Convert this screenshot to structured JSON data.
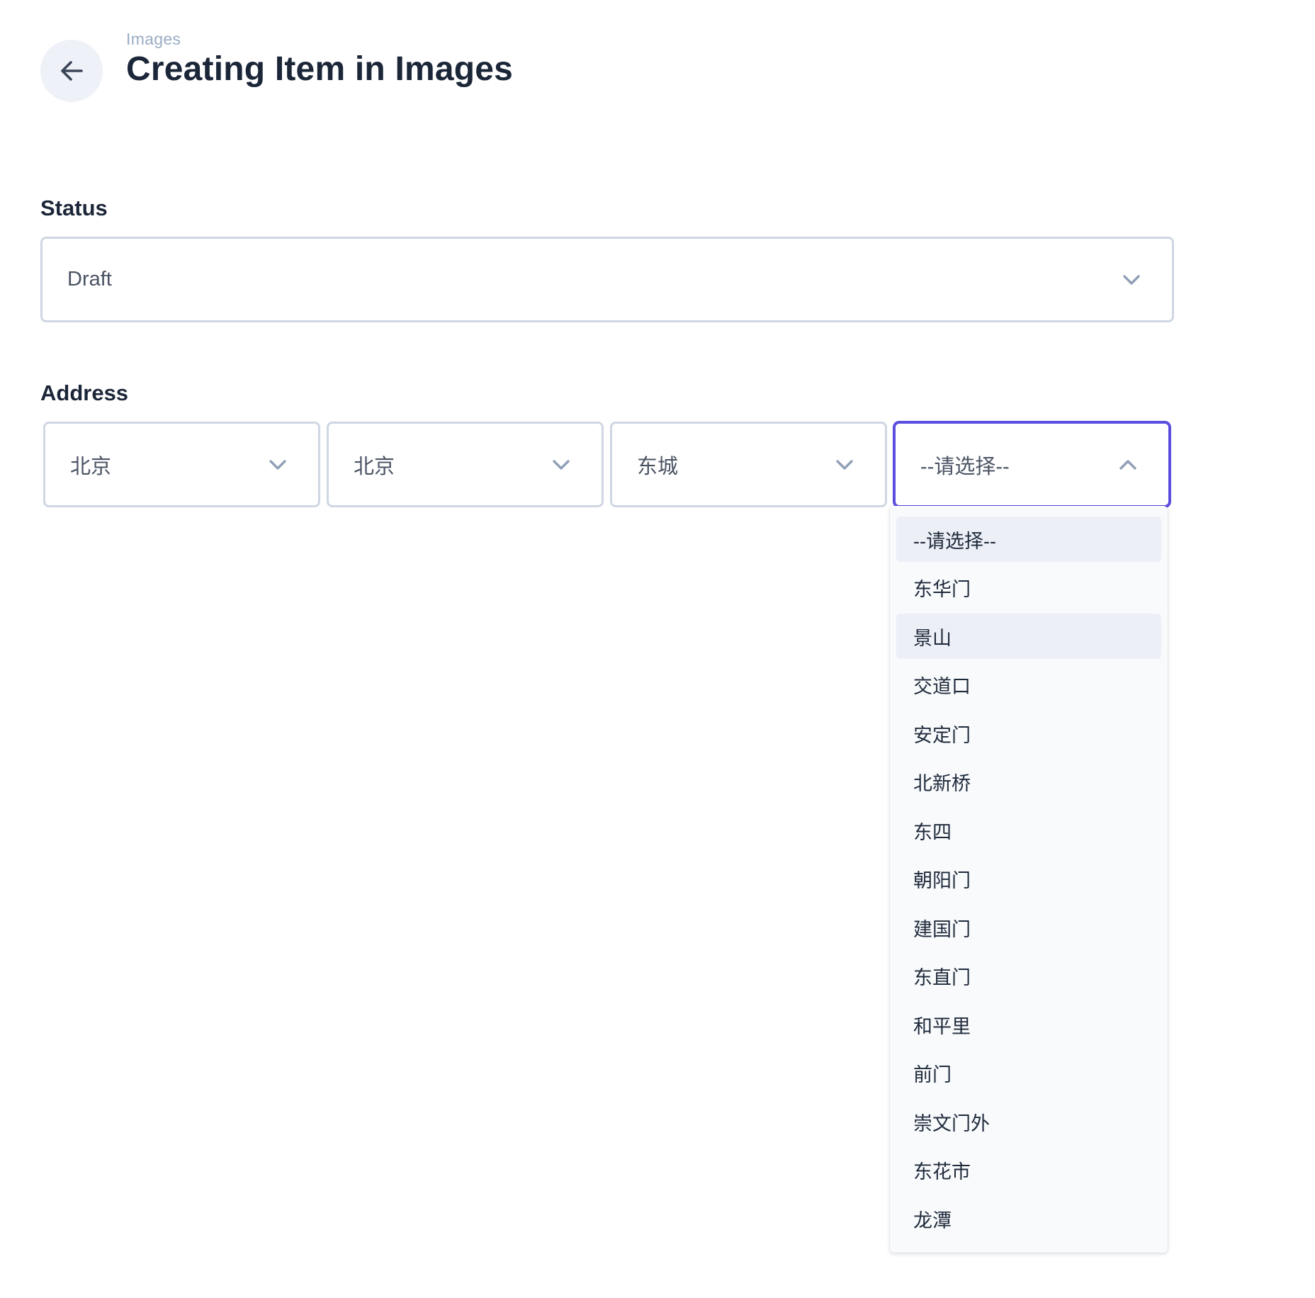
{
  "header": {
    "breadcrumb": "Images",
    "title": "Creating Item in Images",
    "back_icon": "arrow-left-icon"
  },
  "status_field": {
    "label": "Status",
    "value": "Draft",
    "icon": "chevron-down-icon"
  },
  "address_field": {
    "label": "Address",
    "selects": [
      {
        "value": "北京",
        "icon": "chevron-down-icon"
      },
      {
        "value": "北京",
        "icon": "chevron-down-icon"
      },
      {
        "value": "东城",
        "icon": "chevron-down-icon"
      },
      {
        "value": "--请选择--",
        "icon": "chevron-up-icon",
        "open": true
      }
    ],
    "dropdown_options": [
      "--请选择--",
      "东华门",
      "景山",
      "交道口",
      "安定门",
      "北新桥",
      "东四",
      "朝阳门",
      "建国门",
      "东直门",
      "和平里",
      "前门",
      "崇文门外",
      "东花市",
      "龙潭"
    ],
    "selected_option": "--请选择--",
    "hovered_option": "景山"
  },
  "colors": {
    "focus_border": "#5b4de0",
    "border": "#cfd7e3",
    "heading": "#1b2638",
    "breadcrumb": "#9aacc4",
    "chevron": "#8f9fb6"
  }
}
